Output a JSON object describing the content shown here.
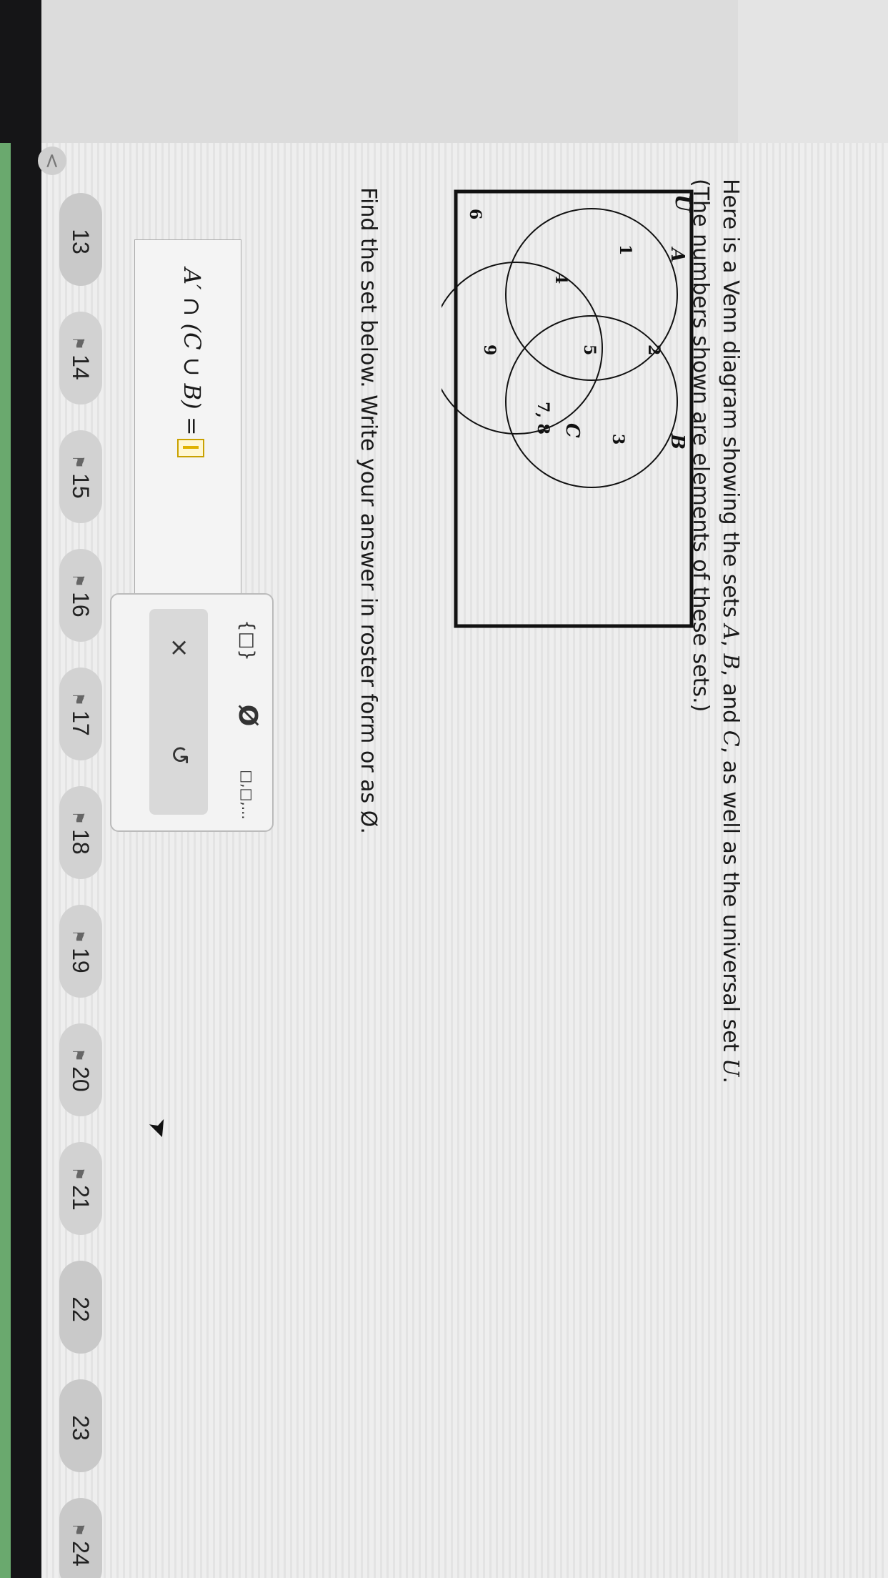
{
  "nav": {
    "back_label": "<",
    "questions": [
      {
        "label": "13",
        "flag": ""
      },
      {
        "label": "14",
        "flag": "⚑"
      },
      {
        "label": "15",
        "flag": "⚑"
      },
      {
        "label": "16",
        "flag": "⚑"
      },
      {
        "label": "17",
        "flag": "⚑"
      },
      {
        "label": "18",
        "flag": "⚑"
      },
      {
        "label": "19",
        "flag": "⚑"
      },
      {
        "label": "20",
        "flag": "⚑"
      },
      {
        "label": "21",
        "flag": "⚑"
      },
      {
        "label": "22",
        "flag": ""
      },
      {
        "label": "23",
        "flag": ""
      },
      {
        "label": "24",
        "flag": "⚑"
      }
    ]
  },
  "question": {
    "intro_prefix": "Here is a Venn diagram showing the sets ",
    "set_a": "A",
    "set_b": "B",
    "set_c": "C",
    "universal": "U",
    "sep1": ", ",
    "sep2": ", and ",
    "intro_suffix": ", as well as the universal set ",
    "period": ".",
    "note": "(The numbers shown are elements of these sets.)",
    "find_text": "Find the set below. Write your answer in roster form or as Ø."
  },
  "venn": {
    "label_u": "U",
    "label_a": "A",
    "label_b": "B",
    "label_c": "C",
    "e_only_a": "1",
    "e_a_b": "2",
    "e_only_b": "3",
    "e_a_c": "4",
    "e_a_b_c": "5",
    "e_b_c": "7, 8",
    "e_only_c": "9",
    "e_outside": "6"
  },
  "answer": {
    "expression": "A′ ∩ (C ∪ B) ="
  },
  "keypad": {
    "empty_set_braces": "{□}",
    "null_symbol": "Ø",
    "list_symbol": "□,□,...",
    "clear": "×",
    "undo": "↺"
  }
}
